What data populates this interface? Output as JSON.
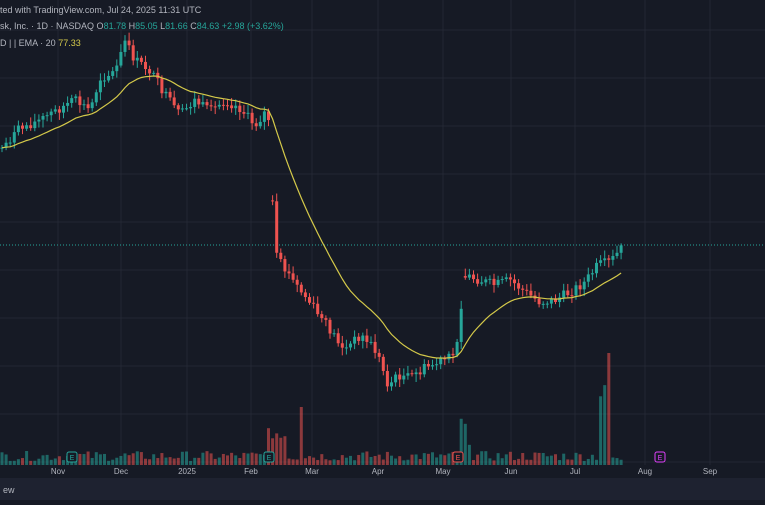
{
  "header": {
    "published": "ted with TradingView.com, Jul 24, 2025 11:31 UTC",
    "symbol": "sk, Inc. · 1D · NASDAQ",
    "o_label": "O",
    "o": "81.78",
    "h_label": "H",
    "h": "85.05",
    "l_label": "L",
    "l": "81.66",
    "c_label": "C",
    "c": "84.63",
    "change": "+2.98 (+3.62%)",
    "ema_label": "D | | EMA · 20",
    "ema_value": "77.33"
  },
  "colors": {
    "background": "#161a25",
    "up": "#26a69a",
    "down": "#ef5350",
    "ema": "#d4c94a",
    "price_line": "#26a69a"
  },
  "chart_data": {
    "type": "candlestick",
    "x_ticks": [
      "Nov",
      "Dec",
      "2025",
      "Feb",
      "Mar",
      "Apr",
      "May",
      "Jun",
      "Jul",
      "Aug",
      "Sep"
    ],
    "last_close": 84.63,
    "ema_period": 20,
    "ema_last": 77.33,
    "events": [
      {
        "label": "E",
        "near": "Oct",
        "color": "#26a69a"
      },
      {
        "label": "E",
        "near": "Feb",
        "color": "#26a69a"
      },
      {
        "label": "E",
        "near": "May",
        "color": "#ef5350"
      },
      {
        "label": "E",
        "near": "Aug",
        "color": "#e040fb"
      }
    ],
    "grid": true,
    "volume_pane": true
  },
  "footer": {
    "brand": "ew"
  }
}
